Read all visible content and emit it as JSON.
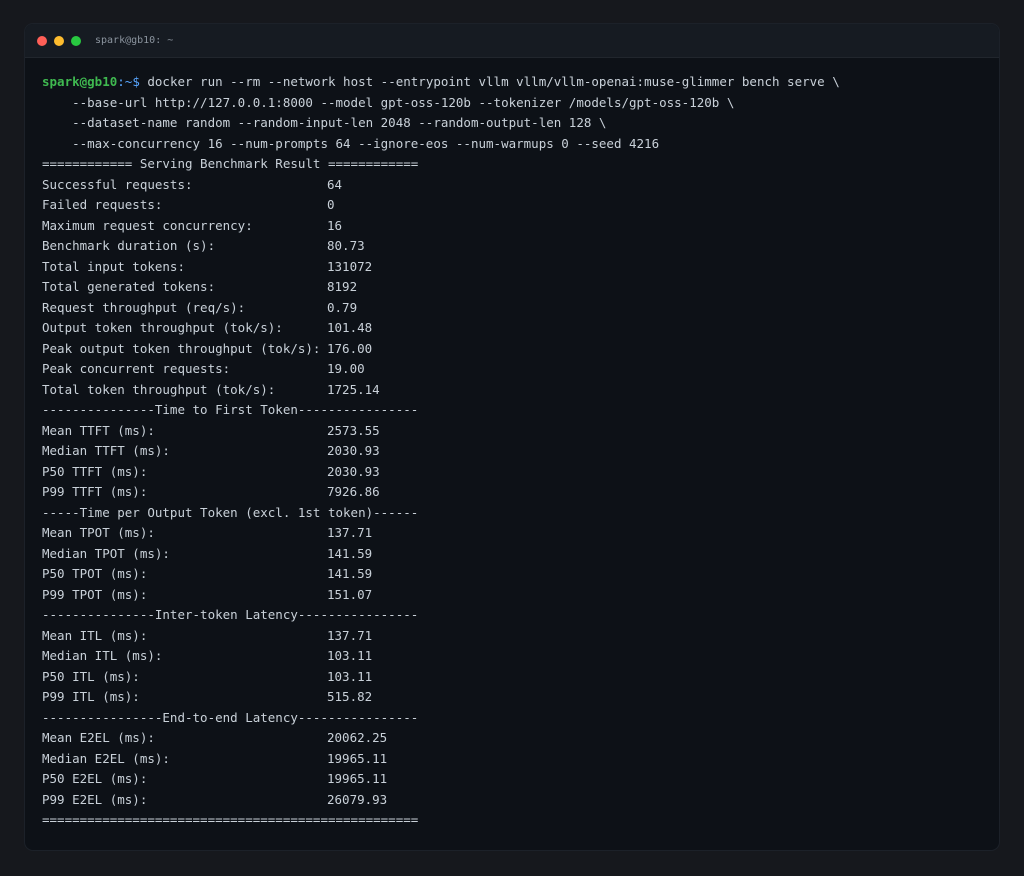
{
  "window": {
    "title": "spark@gb10: ~"
  },
  "prompt": {
    "user": "spark@gb10",
    "path": ":~$ ",
    "command": "docker run --rm --network host --entrypoint vllm vllm/vllm-openai:muse-glimmer bench serve \\"
  },
  "continuations": [
    "    --base-url http://127.0.0.1:8000 --model gpt-oss-120b --tokenizer /models/gpt-oss-120b \\",
    "    --dataset-name random --random-input-len 2048 --random-output-len 128 \\",
    "    --max-concurrency 16 --num-prompts 64 --ignore-eos --num-warmups 0 --seed 4216"
  ],
  "header_line": "============ Serving Benchmark Result ============",
  "summary": [
    {
      "label": "Successful requests:",
      "value": "64"
    },
    {
      "label": "Failed requests:",
      "value": "0"
    },
    {
      "label": "Maximum request concurrency:",
      "value": "16"
    },
    {
      "label": "Benchmark duration (s):",
      "value": "80.73"
    },
    {
      "label": "Total input tokens:",
      "value": "131072"
    },
    {
      "label": "Total generated tokens:",
      "value": "8192"
    },
    {
      "label": "Request throughput (req/s):",
      "value": "0.79"
    },
    {
      "label": "Output token throughput (tok/s):",
      "value": "101.48"
    },
    {
      "label": "Peak output token throughput (tok/s):",
      "value": "176.00"
    },
    {
      "label": "Peak concurrent requests:",
      "value": "19.00"
    },
    {
      "label": "Total token throughput (tok/s):",
      "value": "1725.14"
    }
  ],
  "ttft_header": "---------------Time to First Token----------------",
  "ttft": [
    {
      "label": "Mean TTFT (ms):",
      "value": "2573.55"
    },
    {
      "label": "Median TTFT (ms):",
      "value": "2030.93"
    },
    {
      "label": "P50 TTFT (ms):",
      "value": "2030.93"
    },
    {
      "label": "P99 TTFT (ms):",
      "value": "7926.86"
    }
  ],
  "tpot_header": "-----Time per Output Token (excl. 1st token)------",
  "tpot": [
    {
      "label": "Mean TPOT (ms):",
      "value": "137.71"
    },
    {
      "label": "Median TPOT (ms):",
      "value": "141.59"
    },
    {
      "label": "P50 TPOT (ms):",
      "value": "141.59"
    },
    {
      "label": "P99 TPOT (ms):",
      "value": "151.07"
    }
  ],
  "itl_header": "---------------Inter-token Latency----------------",
  "itl": [
    {
      "label": "Mean ITL (ms):",
      "value": "137.71"
    },
    {
      "label": "Median ITL (ms):",
      "value": "103.11"
    },
    {
      "label": "P50 ITL (ms):",
      "value": "103.11"
    },
    {
      "label": "P99 ITL (ms):",
      "value": "515.82"
    }
  ],
  "e2el_header": "----------------End-to-end Latency----------------",
  "e2el": [
    {
      "label": "Mean E2EL (ms):",
      "value": "20062.25"
    },
    {
      "label": "Median E2EL (ms):",
      "value": "19965.11"
    },
    {
      "label": "P50 E2EL (ms):",
      "value": "19965.11"
    },
    {
      "label": "P99 E2EL (ms):",
      "value": "26079.93"
    }
  ],
  "footer_line": "=================================================="
}
